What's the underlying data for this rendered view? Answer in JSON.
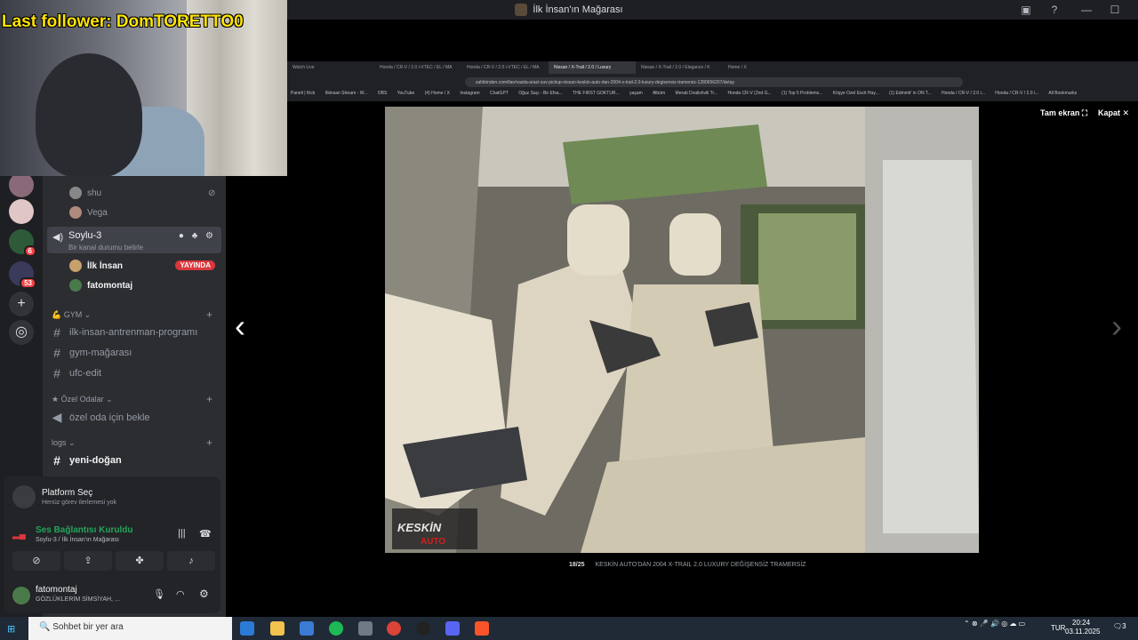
{
  "window": {
    "title": "İlk İnsan'ın Mağarası",
    "controls": [
      "—",
      "☐",
      "✕"
    ]
  },
  "overlay": {
    "follower_text": "Last follower: DomTORETTO0"
  },
  "sidebar": {
    "voice_users_top": [
      "shu",
      "Vega"
    ],
    "active_voice": {
      "name": "Soylu-3",
      "status": "Bir kanal durumu belirle"
    },
    "voice_users": [
      {
        "name": "İlk İnsan",
        "live": "YAYINDA",
        "color": "#c8a06a"
      },
      {
        "name": "fatomontaj",
        "live": "",
        "color": "#4a7a4a"
      }
    ],
    "categories": [
      {
        "name": "GYM",
        "channels": [
          "ilk-insan-antrenman-programı",
          "gym-mağarası",
          "ufc-edit"
        ]
      },
      {
        "name": "Özel Odalar",
        "channels": [
          "özel oda için bekle"
        ]
      },
      {
        "name": "logs",
        "channels": [
          "yeni-doğan"
        ]
      }
    ],
    "server_badges": [
      "6",
      "53"
    ]
  },
  "platform": {
    "title": "Platform Seç",
    "subtitle": "Henüz görev ilerlemesi yok"
  },
  "voice_status": {
    "title": "Ses Bağlantısı Kuruldu",
    "subtitle": "Soylu-3 / İlk İnsan'ın Mağarası"
  },
  "user_panel": {
    "name": "fatomontaj",
    "status": "GÖZLÜKLERİM SİMSİYAH, ..."
  },
  "browser": {
    "tabs": [
      "Watch Live",
      "Honda / CR-V / 2.0 i-VTEC / EL / MA",
      "Honda / CR-V / 2.0 i-VTEC / EL / MA",
      "Nissan / X-Trail / 2.0 / Luxury",
      "Nissan / X-Trail / 2.0 / Elegance / K",
      "Home / X"
    ],
    "url": "sahibinden.com/ilan/vasita-arazi-suv-pickup-nissan-keskin-auto-dan-2004-x-trail-2.0-luxury-degisensiz-tramersiz-1280656207/detay",
    "bookmarks": [
      "Paneli | Kick",
      "İlkinsan Stream - W...",
      "OBS",
      "YouTube",
      "(4) Home / X",
      "Instagram",
      "ChatGPT",
      "Oğuz Saçı - Bir Efsa...",
      "THE FIRST GOKTUR...",
      "yaşam",
      "Albüm",
      "Merab Dvalishvili Tr...",
      "Honda CR-V (2nd G...",
      "(1) Top 5 Problems...",
      "Köşye Özel Excit Hay...",
      "(1) Edmmit' in ON T...",
      "Honda / CR-V / 2.0 i...",
      "Honda / CR-V / 2.0 i...",
      "All Bookmarks"
    ]
  },
  "viewer": {
    "fullscreen": "Tam ekran",
    "close": "Kapat",
    "counter": "18/25",
    "caption": "KESKİN AUTO'DAN 2004 X-TRAIL 2.0 LUXURY DEĞİŞENSİZ TRAMERSİZ",
    "watermark": "KESKİN AUTO"
  },
  "taskbar": {
    "search_placeholder": "Sohbet bir yer ara"
  },
  "tray": {
    "lang": "TUR",
    "time": "20:24",
    "date": "03.11.2025",
    "notifications": "3"
  }
}
